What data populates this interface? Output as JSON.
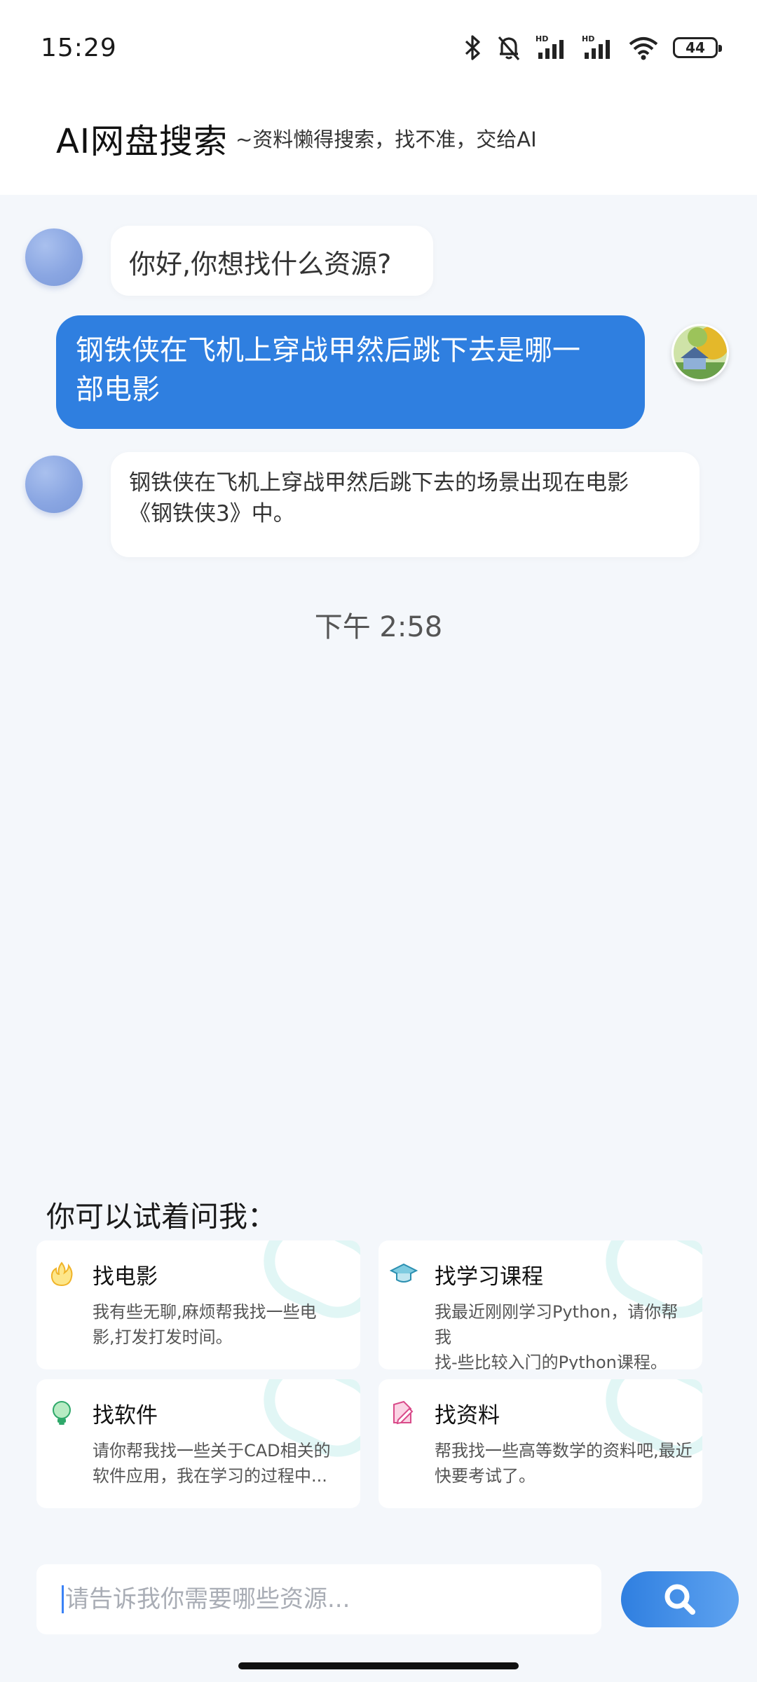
{
  "status_bar": {
    "time": "15:29",
    "battery": "44"
  },
  "header": {
    "title": "AI网盘搜索",
    "subtitle": "~资料懒得搜索，找不准，交给AI"
  },
  "chat": {
    "messages": [
      {
        "role": "bot",
        "text": "你好,你想找什么资源?"
      },
      {
        "role": "user",
        "line1": "钢铁侠在飞机上穿战甲然后跳下去是哪一",
        "line2": "部电影"
      },
      {
        "role": "bot",
        "line1": "钢铁侠在飞机上穿战甲然后跳下去的场景出现在电影",
        "line2": "《钢铁侠3》中。"
      }
    ],
    "time_divider": "下午 2:58"
  },
  "suggestions": {
    "title": "你可以试着问我：",
    "cards": [
      {
        "icon": "fire-icon",
        "title": "找电影",
        "line1": "我有些无聊,麻烦帮我找一些电",
        "line2": "影,打发打发时间。"
      },
      {
        "icon": "graduation-cap-icon",
        "title": "找学习课程",
        "line1": "我最近刚刚学习Python，请你帮我",
        "line2": "找-些比较入门的Python课程。"
      },
      {
        "icon": "lightbulb-icon",
        "title": "找软件",
        "line1": "请你帮我找一些关于CAD相关的",
        "line2": "软件应用，我在学习的过程中..."
      },
      {
        "icon": "pencil-icon",
        "title": "找资料",
        "line1": "帮我找一些高等数学的资料吧,最近",
        "line2": "快要考试了。"
      }
    ]
  },
  "input": {
    "placeholder": "请告诉我你需要哪些资源..."
  },
  "colors": {
    "accent": "#2f7fe0",
    "background": "#f4f7fb"
  }
}
